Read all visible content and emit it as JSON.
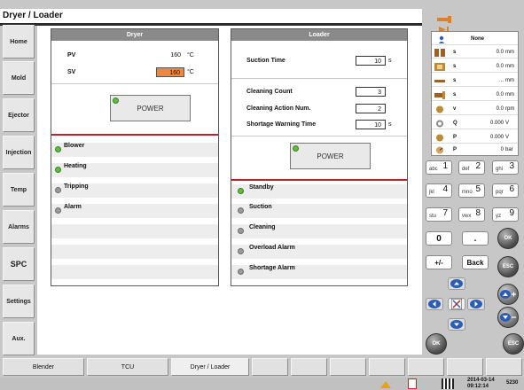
{
  "window": {
    "title": "Dryer / Loader"
  },
  "nav": [
    "Home",
    "Mold",
    "Ejector",
    "Injection",
    "Temp",
    "Alarms",
    "SPC",
    "Settings",
    "Aux."
  ],
  "dryer": {
    "title": "Dryer",
    "pv": {
      "label": "PV",
      "value": "160",
      "unit": "°C"
    },
    "sv": {
      "label": "SV",
      "value": "160",
      "unit": "°C"
    },
    "power_label": "POWER",
    "status": [
      {
        "label": "Blower",
        "on": true
      },
      {
        "label": "Heating",
        "on": true
      },
      {
        "label": "Tripping",
        "on": false
      },
      {
        "label": "Alarm",
        "on": false
      }
    ]
  },
  "loader": {
    "title": "Loader",
    "suction_time": {
      "label": "Suction Time",
      "value": "10",
      "unit": "s"
    },
    "cleaning_count": {
      "label": "Cleaning Count",
      "value": "3"
    },
    "cleaning_action": {
      "label": "Cleaning Action Num.",
      "value": "2"
    },
    "shortage_time": {
      "label": "Shortage Warning Time",
      "value": "10",
      "unit": "s"
    },
    "power_label": "POWER",
    "status": [
      {
        "label": "Standby",
        "on": true
      },
      {
        "label": "Suction",
        "on": false
      },
      {
        "label": "Cleaning",
        "on": false
      },
      {
        "label": "Overload Alarm",
        "on": false
      },
      {
        "label": "Shortage Alarm",
        "on": false
      }
    ]
  },
  "tabs": [
    "Blender",
    "TCU",
    "Dryer / Loader",
    "",
    "",
    "",
    "",
    "",
    "",
    ""
  ],
  "machine_status": {
    "mode": "None",
    "rows": [
      {
        "icon": "mold-icon",
        "label": "s",
        "value": "0.0",
        "unit": "mm"
      },
      {
        "icon": "ejector-icon",
        "label": "s",
        "value": "0.0",
        "unit": "mm"
      },
      {
        "icon": "core-icon",
        "label": "s",
        "value": "...",
        "unit": "mm"
      },
      {
        "icon": "screw-icon",
        "label": "s",
        "value": "0.0",
        "unit": "mm"
      },
      {
        "icon": "rotation-icon",
        "label": "v",
        "value": "0.0",
        "unit": "rpm"
      },
      {
        "icon": "pump-icon",
        "label": "Q",
        "value": "0.000",
        "unit": "V"
      },
      {
        "icon": "pressure-icon",
        "label": "P",
        "value": "0.000",
        "unit": "V"
      },
      {
        "icon": "gauge-icon",
        "label": "P",
        "value": "0",
        "unit": "bar"
      }
    ]
  },
  "keypad": {
    "keys": [
      {
        "sub": "abc",
        "main": "1"
      },
      {
        "sub": "def",
        "main": "2"
      },
      {
        "sub": "ghi",
        "main": "3"
      },
      {
        "sub": "jkl",
        "main": "4"
      },
      {
        "sub": "mno",
        "main": "5"
      },
      {
        "sub": "pqr",
        "main": "6"
      },
      {
        "sub": "stu",
        "main": "7"
      },
      {
        "sub": "vwx",
        "main": "8"
      },
      {
        "sub": "yz",
        "main": "9"
      }
    ],
    "zero": "0",
    "dot": ".",
    "plusminus": "+/-",
    "back": "Back",
    "ok": "OK",
    "esc": "ESC",
    "ok2": "OK",
    "esc2": "ESC"
  },
  "footer": {
    "date": "2014-03-14",
    "time": "09:12:14",
    "code": "5230"
  }
}
